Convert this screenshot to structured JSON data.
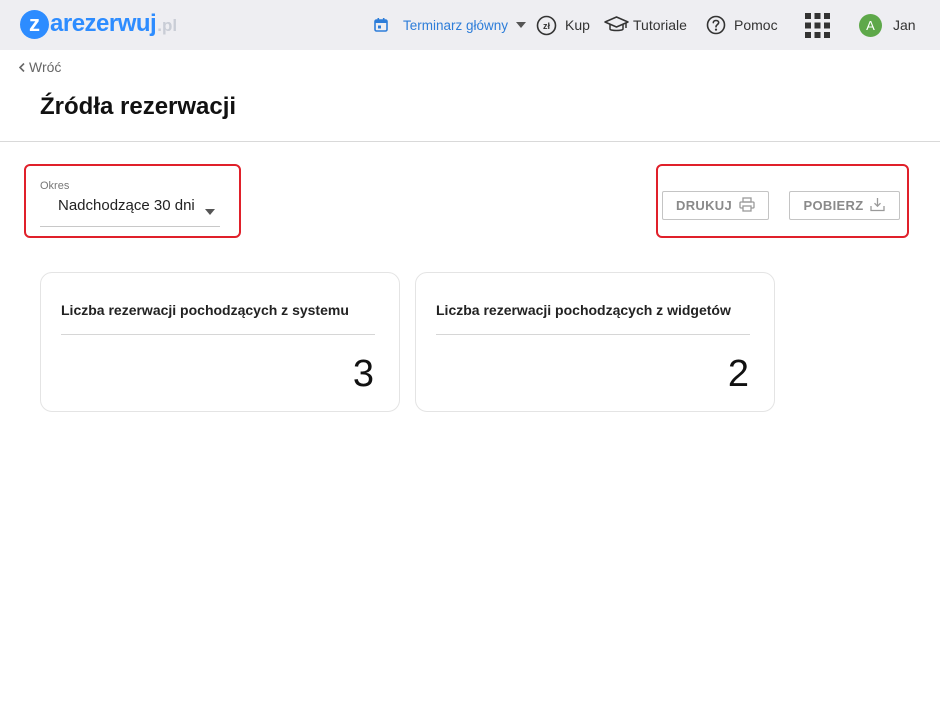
{
  "logo": {
    "initial": "z",
    "name": "arezerwuj",
    "tld": ".pl"
  },
  "nav": {
    "calendar": {
      "label": "Terminarz główny"
    },
    "buy": {
      "label": "Kup"
    },
    "tutorials": {
      "label": "Tutoriale"
    },
    "help": {
      "label": "Pomoc"
    },
    "user": {
      "avatar_initial": "A",
      "name": "Jan",
      "avatar_color": "#5ea84a"
    }
  },
  "header": {
    "back_label": "Wróć",
    "title": "Źródła rezerwacji"
  },
  "filters": {
    "period": {
      "label": "Okres",
      "value": "Nadchodzące 30 dni"
    }
  },
  "actions": {
    "print_label": "DRUKUJ",
    "download_label": "POBIERZ"
  },
  "cards": [
    {
      "title": "Liczba rezerwacji pochodzących z systemu",
      "value": "3"
    },
    {
      "title": "Liczba rezerwacji pochodzących z widgetów",
      "value": "2"
    }
  ],
  "colors": {
    "brand": "#2d8cff",
    "accent_nav": "#2d7dd9",
    "highlight": "#e0202a",
    "topbar_bg": "#eeeef2"
  },
  "icons": {
    "calendar": "calendar-icon",
    "buy": "zloty-coin-icon",
    "tutorials": "graduation-cap-icon",
    "help": "question-circle-icon",
    "apps": "apps-grid-icon",
    "print": "printer-icon",
    "download": "download-icon"
  }
}
